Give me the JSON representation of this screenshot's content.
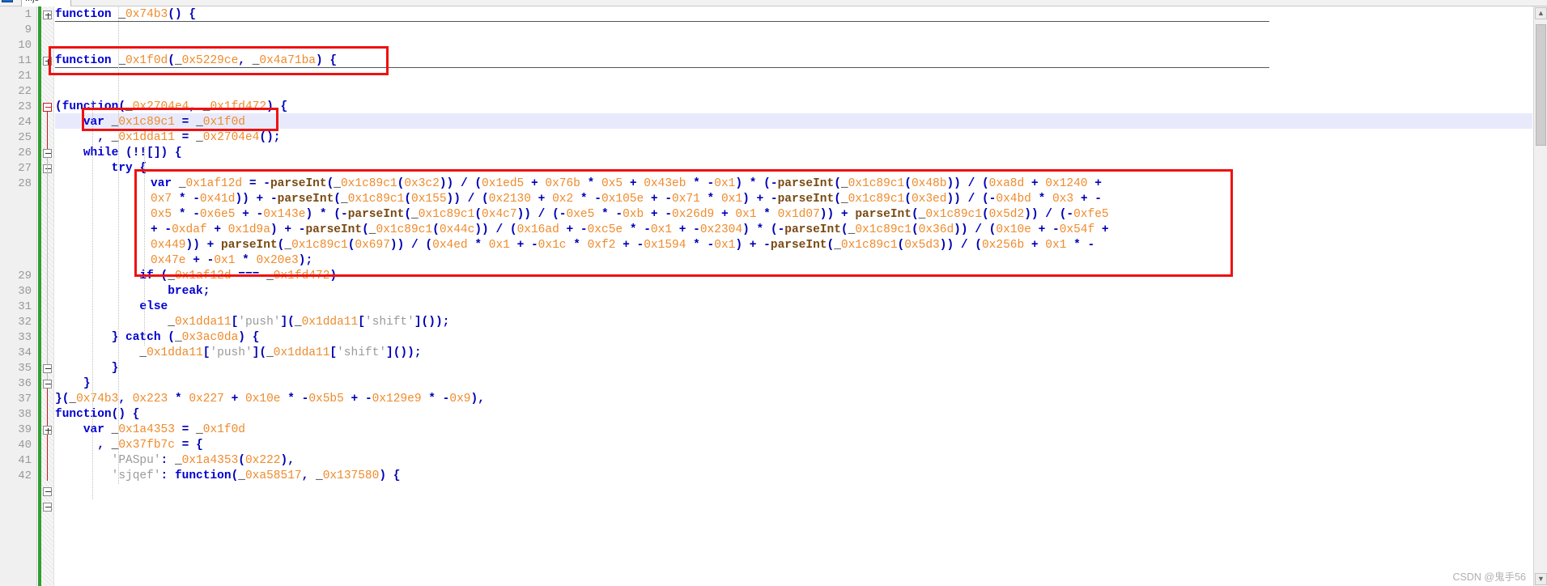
{
  "window": {
    "tab_label": "...js",
    "watermark": "CSDN @鬼手56"
  },
  "editor": {
    "language": "javascript",
    "scrollbar": {
      "up_arrow": "▲",
      "down_arrow": "▼"
    },
    "line_numbers": [
      "1",
      "9",
      "10",
      "11",
      "21",
      "22",
      "23",
      "24",
      "25",
      "26",
      "27",
      "28",
      "29",
      "30",
      "31",
      "32",
      "33",
      "34",
      "35",
      "36",
      "37",
      "38",
      "39",
      "40",
      "41",
      "42"
    ],
    "highlighted_line": "24",
    "occurrence_token": "_0x1c89c1"
  },
  "code_lines": [
    {
      "num": "1",
      "text": "function _0x74b3() {"
    },
    {
      "num": "9",
      "text": ""
    },
    {
      "num": "10",
      "text": ""
    },
    {
      "num": "11",
      "text": "function _0x1f0d(_0x5229ce, _0x4a71ba) {"
    },
    {
      "num": "21",
      "text": ""
    },
    {
      "num": "22",
      "text": ""
    },
    {
      "num": "23",
      "text": "(function(_0x2704e4, _0x1fd472) {"
    },
    {
      "num": "24",
      "text": "    var _0x1c89c1 = _0x1f0d"
    },
    {
      "num": "25",
      "text": "      , _0x1dda11 = _0x2704e4();"
    },
    {
      "num": "26",
      "text": "    while (!![]) {"
    },
    {
      "num": "27",
      "text": "        try {"
    },
    {
      "num": "28",
      "text": "            var _0x1af12d = -parseInt(_0x1c89c1(0x3c2)) / (0x1ed5 + 0x76b * 0x5 + 0x43eb * -0x1) * (-parseInt(_0x1c89c1(0x48b)) / (0xa8d + 0x1240 + 0x7 * -0x41d)) + -parseInt(_0x1c89c1(0x155)) / (0x2130 + 0x2 * -0x105e + -0x71 * 0x1) + -parseInt(_0x1c89c1(0x3ed)) / (-0x4bd * 0x3 + -0x5 * -0x6e5 + -0x143e) * (-parseInt(_0x1c89c1(0x4c7)) / (-0xe5 * -0xb + -0x26d9 + 0x1 * 0x1d07)) + parseInt(_0x1c89c1(0x5d2)) / (-0xfe5 + -0xdaf + 0x1d9a) + -parseInt(_0x1c89c1(0x44c)) / (0x16ad + -0xc5e * -0x1 + -0x2304) * (-parseInt(_0x1c89c1(0x36d)) / (0x10e + -0x54f + 0x449)) + parseInt(_0x1c89c1(0x697)) / (0x4ed * 0x1 + -0x1c * 0xf2 + -0x1594 * -0x1) + -parseInt(_0x1c89c1(0x5d3)) / (0x256b + 0x1 * -0x47e + -0x1 * 0x20e3);"
    },
    {
      "num": "29",
      "text": "            if (_0x1af12d === _0x1fd472)"
    },
    {
      "num": "30",
      "text": "                break;"
    },
    {
      "num": "31",
      "text": "            else"
    },
    {
      "num": "32",
      "text": "                _0x1dda11['push'](_0x1dda11['shift']());"
    },
    {
      "num": "33",
      "text": "        } catch (_0x3ac0da) {"
    },
    {
      "num": "34",
      "text": "            _0x1dda11['push'](_0x1dda11['shift']());"
    },
    {
      "num": "35",
      "text": "        }"
    },
    {
      "num": "36",
      "text": "    }"
    },
    {
      "num": "37",
      "text": "}(_0x74b3, 0x223 * 0x227 + 0x10e * -0x5b5 + -0x129e9 * -0x9),"
    },
    {
      "num": "38",
      "text": "function() {"
    },
    {
      "num": "39",
      "text": "    var _0x1a4353 = _0x1f0d"
    },
    {
      "num": "40",
      "text": "      , _0x37fb7c = {"
    },
    {
      "num": "41",
      "text": "        'PASpu': _0x1a4353(0x222),"
    },
    {
      "num": "42",
      "text": "        'sjqef': function(_0xa58517, _0x137580) {"
    }
  ],
  "line28_segments_row1": "var _0x1af12d = -parseInt(_0x1c89c1(0x3c2)) / (0x1ed5 + 0x76b * 0x5 + 0x43eb * -0x1) * (-parseInt(_0x1c89c1(0x48b)) / (0xa8d + 0x1240 +",
  "line28_segments_row2": "0x7 * -0x41d)) + -parseInt(_0x1c89c1(0x155)) / (0x2130 + 0x2 * -0x105e + -0x71 * 0x1) + -parseInt(_0x1c89c1(0x3ed)) / (-0x4bd * 0x3 + -",
  "line28_segments_row3": "0x5 * -0x6e5 + -0x143e) * (-parseInt(_0x1c89c1(0x4c7)) / (-0xe5 * -0xb + -0x26d9 + 0x1 * 0x1d07)) + parseInt(_0x1c89c1(0x5d2)) / (-0xfe5",
  "line28_segments_row4": "+ -0xdaf + 0x1d9a) + -parseInt(_0x1c89c1(0x44c)) / (0x16ad + -0xc5e * -0x1 + -0x2304) * (-parseInt(_0x1c89c1(0x36d)) / (0x10e + -0x54f +",
  "line28_segments_row5": "0x449)) + parseInt(_0x1c89c1(0x697)) / (0x4ed * 0x1 + -0x1c * 0xf2 + -0x1594 * -0x1) + -parseInt(_0x1c89c1(0x5d3)) / (0x256b + 0x1 * -",
  "line28_segments_row6": "0x47e + -0x1 * 0x20e3);",
  "annotations": [
    {
      "id": "annot-function-signature",
      "label": "function _0x1f0d signature highlight"
    },
    {
      "id": "annot-var-declaration",
      "label": "var _0x1c89c1 = _0x1f0d highlight"
    },
    {
      "id": "annot-parseint-block",
      "label": "parseInt checksum expression highlight"
    }
  ]
}
